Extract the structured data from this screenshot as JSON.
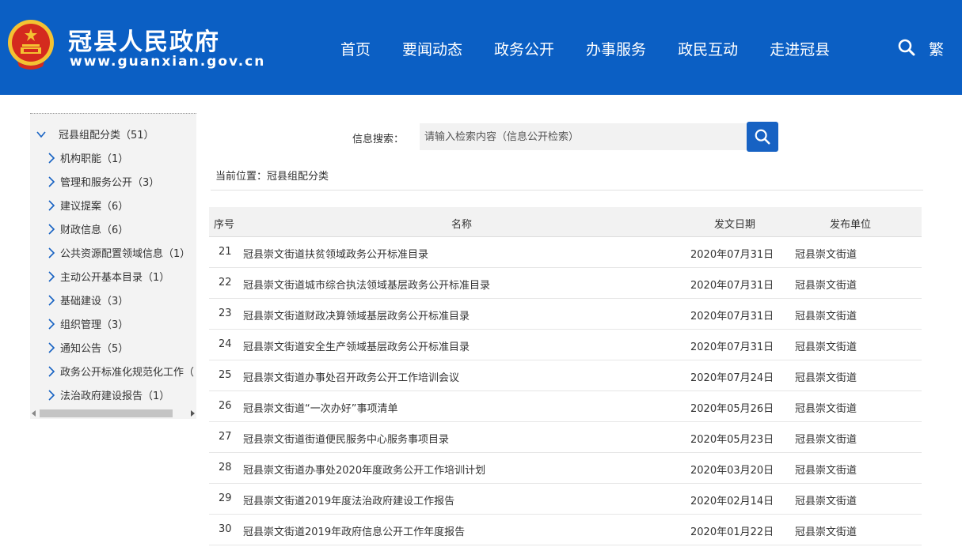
{
  "header": {
    "site_title": "冠县人民政府",
    "site_url": "www.guanxian.gov.cn",
    "nav": [
      "首页",
      "要闻动态",
      "政务公开",
      "办事服务",
      "政民互动",
      "走进冠县"
    ],
    "traditional_label": "繁",
    "colors": {
      "header_bg": "#0b5fc4",
      "emblem_red": "#d42a1e",
      "emblem_gold": "#f4c232"
    }
  },
  "sidebar": {
    "root_label": "冠县组配分类（51）",
    "items": [
      "机构职能（1）",
      "管理和服务公开（3）",
      "建议提案（6）",
      "财政信息（6）",
      "公共资源配置领域信息（1）",
      "主动公开基本目录（1）",
      "基础建设（3）",
      "组织管理（3）",
      "通知公告（5）",
      "政务公开标准化规范化工作（",
      "法治政府建设报告（1）"
    ]
  },
  "search": {
    "label": "信息搜索：",
    "placeholder": "请输入检索内容（信息公开检索）",
    "button_icon": "search-icon"
  },
  "breadcrumb": "当前位置：冠县组配分类",
  "table": {
    "headers": {
      "num": "序号",
      "name": "名称",
      "date": "发文日期",
      "unit": "发布单位"
    },
    "rows": [
      {
        "num": "21",
        "name": "冠县崇文街道扶贫领域政务公开标准目录",
        "date": "2020年07月31日",
        "unit": "冠县崇文街道"
      },
      {
        "num": "22",
        "name": "冠县崇文街道城市综合执法领域基层政务公开标准目录",
        "date": "2020年07月31日",
        "unit": "冠县崇文街道"
      },
      {
        "num": "23",
        "name": "冠县崇文街道财政决算领域基层政务公开标准目录",
        "date": "2020年07月31日",
        "unit": "冠县崇文街道"
      },
      {
        "num": "24",
        "name": "冠县崇文街道安全生产领域基层政务公开标准目录",
        "date": "2020年07月31日",
        "unit": "冠县崇文街道"
      },
      {
        "num": "25",
        "name": "冠县崇文街道办事处召开政务公开工作培训会议",
        "date": "2020年07月24日",
        "unit": "冠县崇文街道"
      },
      {
        "num": "26",
        "name": "冠县崇文街道“一次办好”事项清单",
        "date": "2020年05月26日",
        "unit": "冠县崇文街道"
      },
      {
        "num": "27",
        "name": "冠县崇文街道街道便民服务中心服务事项目录",
        "date": "2020年05月23日",
        "unit": "冠县崇文街道"
      },
      {
        "num": "28",
        "name": "冠县崇文街道办事处2020年度政务公开工作培训计划",
        "date": "2020年03月20日",
        "unit": "冠县崇文街道"
      },
      {
        "num": "29",
        "name": "冠县崇文街道2019年度法治政府建设工作报告",
        "date": "2020年02月14日",
        "unit": "冠县崇文街道"
      },
      {
        "num": "30",
        "name": "冠县崇文街道2019年政府信息公开工作年度报告",
        "date": "2020年01月22日",
        "unit": "冠县崇文街道"
      }
    ]
  }
}
